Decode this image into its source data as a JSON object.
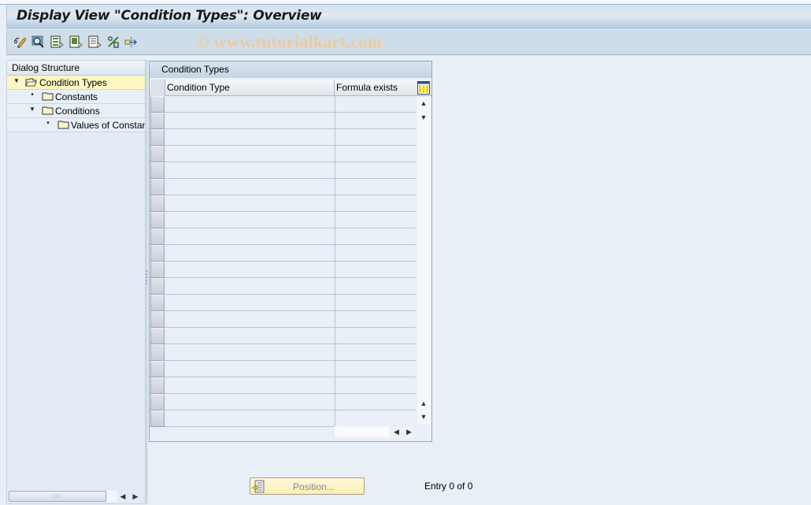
{
  "window": {
    "title": "Display View \"Condition Types\": Overview",
    "watermark": "© www.tutorialkart.com"
  },
  "toolbar": {
    "icons": [
      {
        "name": "display-change-icon"
      },
      {
        "name": "find-icon"
      },
      {
        "name": "select-all-icon"
      },
      {
        "name": "select-block-icon"
      },
      {
        "name": "deselect-all-icon"
      },
      {
        "name": "print-standard-list-icon"
      },
      {
        "name": "transport-icon"
      }
    ]
  },
  "dialog_structure": {
    "header": "Dialog Structure",
    "items": [
      {
        "label": "Condition Types",
        "level": 0,
        "expander": "expanded",
        "open_folder": true,
        "selected": true
      },
      {
        "label": "Constants",
        "level": 1,
        "expander": "leaf",
        "open_folder": false,
        "selected": false
      },
      {
        "label": "Conditions",
        "level": 1,
        "expander": "expanded",
        "open_folder": false,
        "selected": false
      },
      {
        "label": "Values of Constants",
        "level": 2,
        "expander": "leaf",
        "open_folder": false,
        "selected": false
      }
    ]
  },
  "table": {
    "caption": "Condition Types",
    "columns": [
      "Condition Type",
      "Formula exists"
    ],
    "row_count": 20,
    "rows": []
  },
  "footer": {
    "position_button": "Position...",
    "entry_info": "Entry 0 of 0"
  },
  "colors": {
    "selected_tree_row": "#fdf6c2",
    "position_button": "#fbeeb0",
    "watermark": "#f0c89a"
  }
}
